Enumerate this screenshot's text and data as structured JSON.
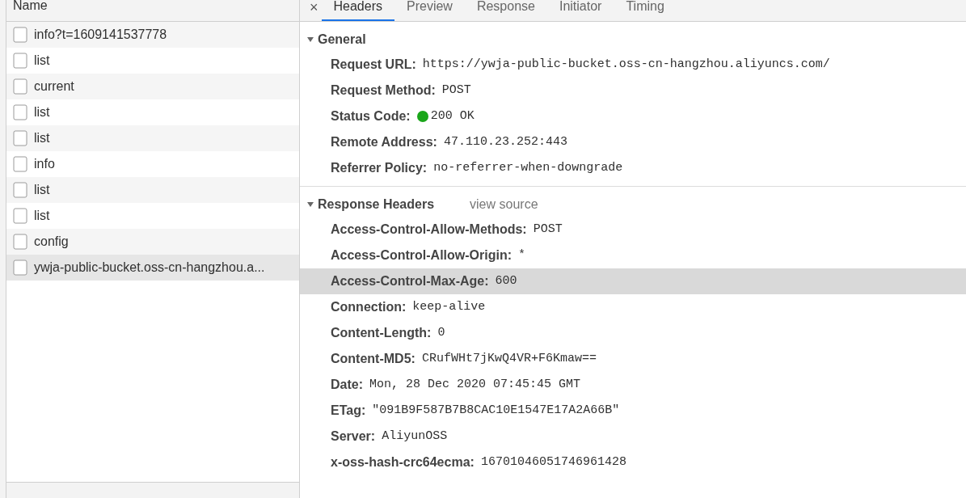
{
  "requests": {
    "column": "Name",
    "rows": [
      {
        "name": "info?t=1609141537778",
        "selected": false
      },
      {
        "name": "list",
        "selected": false
      },
      {
        "name": "current",
        "selected": false
      },
      {
        "name": "list",
        "selected": false
      },
      {
        "name": "list",
        "selected": false
      },
      {
        "name": "info",
        "selected": false
      },
      {
        "name": "list",
        "selected": false
      },
      {
        "name": "list",
        "selected": false
      },
      {
        "name": "config",
        "selected": false
      },
      {
        "name": "ywja-public-bucket.oss-cn-hangzhou.a...",
        "selected": true
      }
    ]
  },
  "close": "×",
  "tabs": [
    {
      "label": "Headers",
      "selected": true
    },
    {
      "label": "Preview",
      "selected": false
    },
    {
      "label": "Response",
      "selected": false
    },
    {
      "label": "Initiator",
      "selected": false
    },
    {
      "label": "Timing",
      "selected": false
    }
  ],
  "sections": [
    {
      "title": "General",
      "expanded": true,
      "rows": [
        {
          "key": "Request URL:",
          "value": "https://ywja-public-bucket.oss-cn-hangzhou.aliyuncs.com/",
          "selected": false
        },
        {
          "key": "Request Method:",
          "value": "POST",
          "selected": false
        },
        {
          "key": "Status Code:",
          "value": "200 OK",
          "selected": false,
          "color": "#1aa61a"
        },
        {
          "key": "Remote Address:",
          "value": "47.110.23.252:443",
          "selected": false
        },
        {
          "key": "Referrer Policy:",
          "value": "no-referrer-when-downgrade",
          "selected": false
        }
      ]
    },
    {
      "title": "Response Headers",
      "link": "view source",
      "expanded": true,
      "rows": [
        {
          "key": "Access-Control-Allow-Methods:",
          "value": "POST",
          "selected": false
        },
        {
          "key": "Access-Control-Allow-Origin:",
          "value": "*",
          "selected": false
        },
        {
          "key": "Access-Control-Max-Age:",
          "value": "600",
          "selected": true
        },
        {
          "key": "Connection:",
          "value": "keep-alive",
          "selected": false
        },
        {
          "key": "Content-Length:",
          "value": "0",
          "selected": false
        },
        {
          "key": "Content-MD5:",
          "value": "CRufWHt7jKwQ4VR+F6Kmaw==",
          "selected": false
        },
        {
          "key": "Date:",
          "value": "Mon, 28 Dec 2020 07:45:45 GMT",
          "selected": false
        },
        {
          "key": "ETag:",
          "value": "\"091B9F587B7B8CAC10E1547E17A2A66B\"",
          "selected": false
        },
        {
          "key": "Server:",
          "value": "AliyunOSS",
          "selected": false
        },
        {
          "key": "x-oss-hash-crc64ecma:",
          "value": "16701046051746961428",
          "selected": false
        }
      ]
    }
  ]
}
